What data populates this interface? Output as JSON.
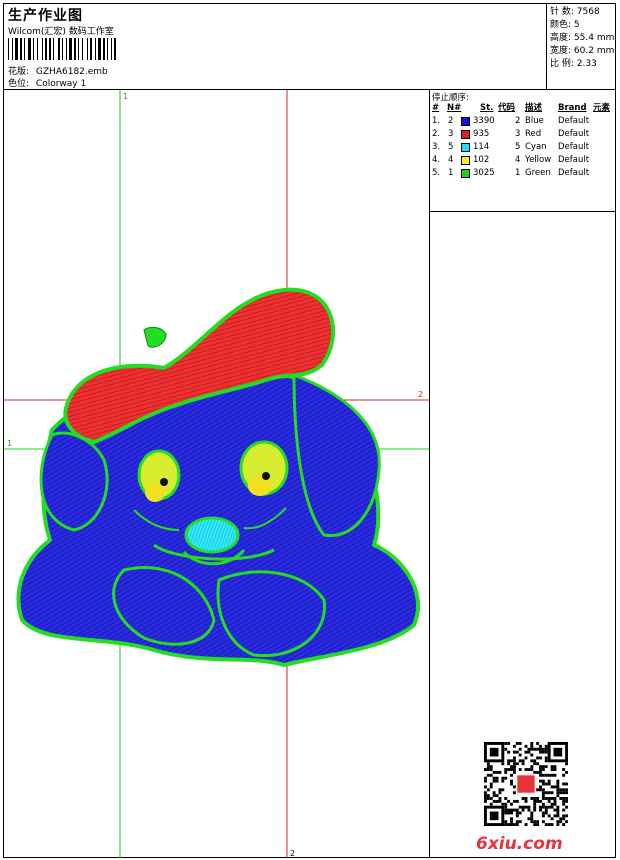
{
  "header": {
    "title": "生产作业图",
    "subtitle": "Wilcom(汇宏) 数码工作室",
    "design_label": "花版:",
    "design_value": "GZHA6182.emb",
    "colorway_label": "色位:",
    "colorway_value": "Colorway 1"
  },
  "stats": [
    {
      "label": "针 数:",
      "value": "7568"
    },
    {
      "label": "颜色:",
      "value": "5"
    },
    {
      "label": "高度:",
      "value": "55.4 mm"
    },
    {
      "label": "宽度:",
      "value": "60.2 mm"
    },
    {
      "label": "比 例:",
      "value": "2.33"
    }
  ],
  "stop_table": {
    "title": "停止顺序:",
    "columns": [
      "#",
      "N#",
      "St.",
      "代码",
      "描述",
      "Brand",
      "元素"
    ],
    "rows": [
      {
        "idx": "1.",
        "n": "2",
        "code": "3390",
        "stop": "2",
        "desc": "Blue",
        "brand": "Default",
        "color": "#1010d8"
      },
      {
        "idx": "2.",
        "n": "3",
        "code": "935",
        "stop": "3",
        "desc": "Red",
        "brand": "Default",
        "color": "#e02020"
      },
      {
        "idx": "3.",
        "n": "5",
        "code": "114",
        "stop": "5",
        "desc": "Cyan",
        "brand": "Default",
        "color": "#20e0f0"
      },
      {
        "idx": "4.",
        "n": "4",
        "code": "102",
        "stop": "4",
        "desc": "Yellow",
        "brand": "Default",
        "color": "#f0f020"
      },
      {
        "idx": "5.",
        "n": "1",
        "code": "3025",
        "stop": "1",
        "desc": "Green",
        "brand": "Default",
        "color": "#20d020"
      }
    ]
  },
  "guides": {
    "v1": "1",
    "h1": "1",
    "v2": "2",
    "h2": "2"
  },
  "colors": {
    "green": "#22cc22",
    "red": "#e02020",
    "blue": "#1818d0",
    "cyan": "#20d8f0",
    "yellow": "#f0e020"
  },
  "watermark": "6xiu.com"
}
